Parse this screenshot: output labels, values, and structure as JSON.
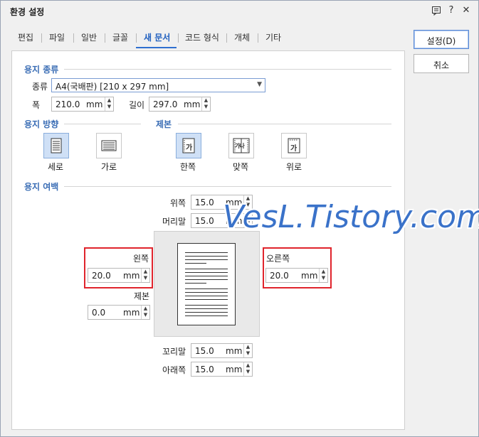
{
  "window": {
    "title": "환경 설정",
    "help_icon": "chat-icon",
    "question": "?",
    "close": "✕"
  },
  "tabs": [
    {
      "label": "편집"
    },
    {
      "label": "파일"
    },
    {
      "label": "일반"
    },
    {
      "label": "글꼴"
    },
    {
      "label": "새 문서",
      "active": true
    },
    {
      "label": "코드 형식"
    },
    {
      "label": "개체"
    },
    {
      "label": "기타"
    }
  ],
  "buttons": {
    "ok": "설정(D)",
    "cancel": "취소"
  },
  "paper_type": {
    "section": "용지 종류",
    "type_label": "종류",
    "type_value": "A4(국배판)  [210 x 297 mm]",
    "width_label": "폭",
    "width_value": "210.0",
    "length_label": "길이",
    "length_value": "297.0",
    "unit": "mm"
  },
  "orientation": {
    "section": "용지 방향",
    "portrait": "세로",
    "landscape": "가로",
    "selected": "세로"
  },
  "binding": {
    "section": "제본",
    "one_side": "한쪽",
    "facing": "맞쪽",
    "top": "위로",
    "selected": "한쪽",
    "glyph_one": "가",
    "glyph_facing": "가나",
    "glyph_top": "가"
  },
  "margins": {
    "section": "용지 여백",
    "top_label": "위쪽",
    "top_value": "15.0",
    "header_label": "머리말",
    "header_value": "15.0",
    "left_label": "왼쪽",
    "left_value": "20.0",
    "gutter_label": "제본",
    "gutter_value": "0.0",
    "right_label": "오른쪽",
    "right_value": "20.0",
    "footer_label": "꼬리말",
    "footer_value": "15.0",
    "bottom_label": "아래쪽",
    "bottom_value": "15.0",
    "unit": "mm"
  },
  "watermark": "VesL.Tistory.com",
  "colors": {
    "accent": "#3a6db5",
    "highlight": "#e0242c",
    "selected": "#cfe0f6"
  }
}
